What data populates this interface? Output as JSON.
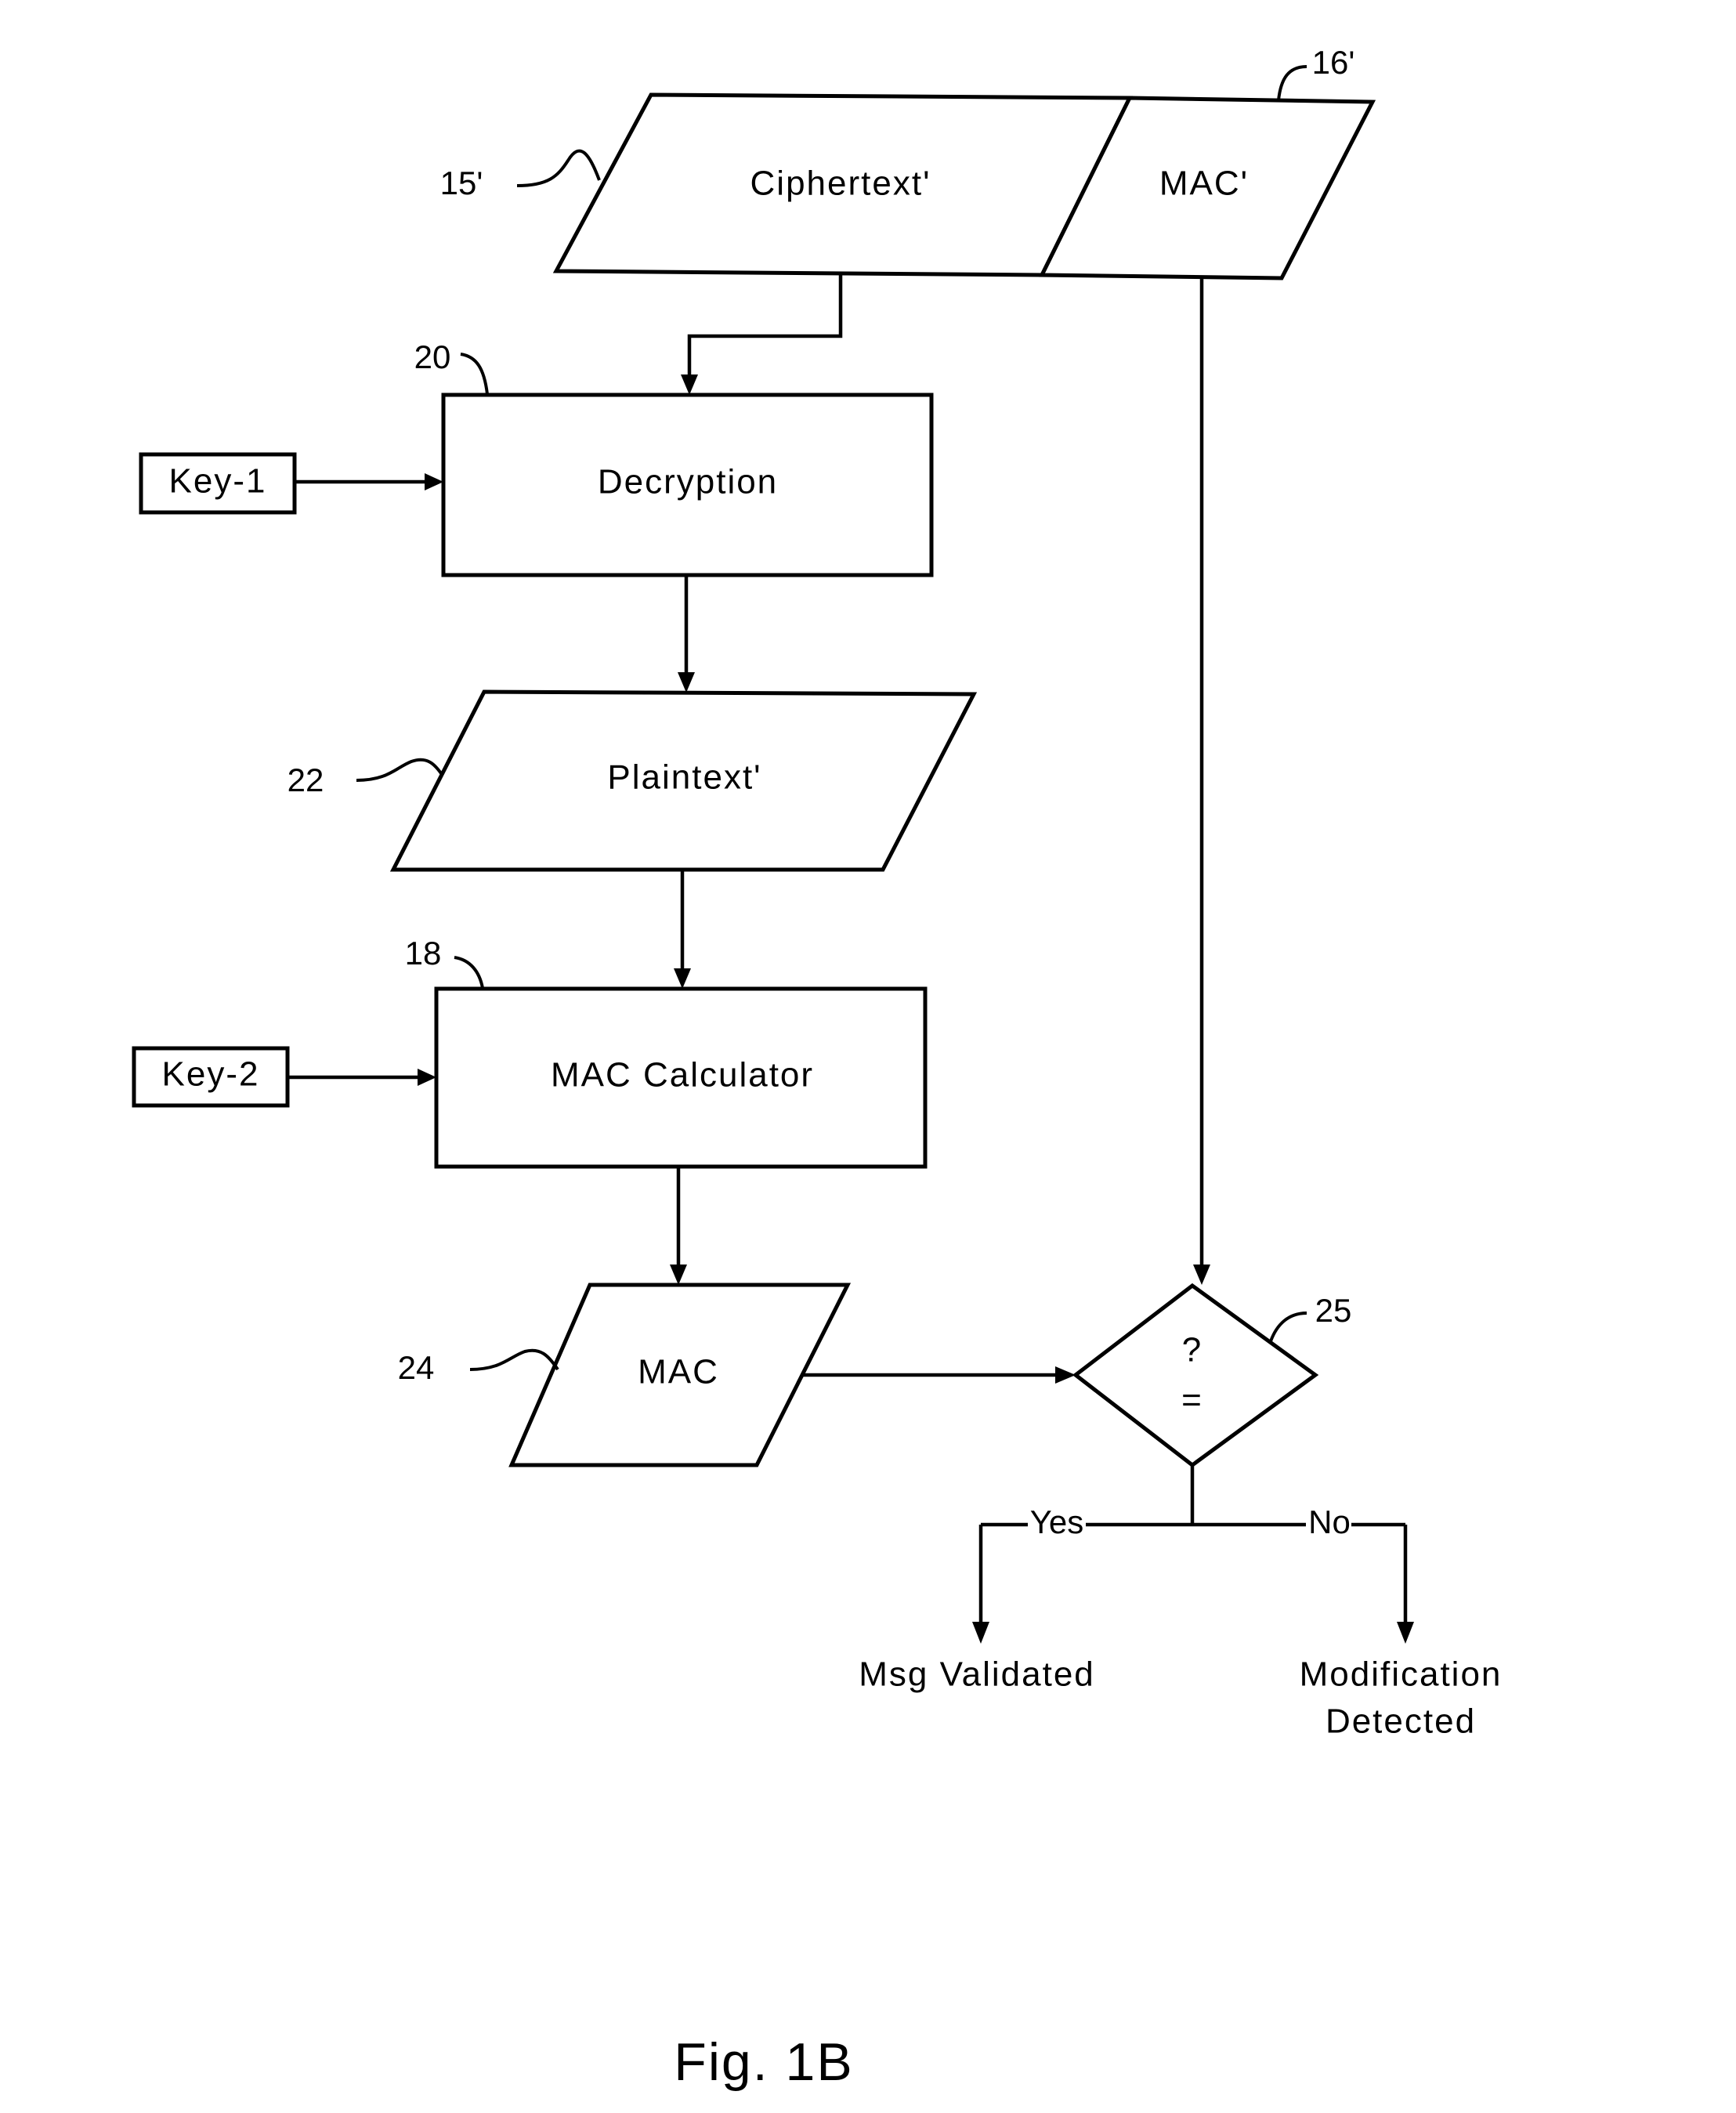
{
  "figure_label": "Fig. 1B",
  "nodes": {
    "ciphertext": {
      "label": "Ciphertext'",
      "ref": "15'"
    },
    "mac_received": {
      "label": "MAC'",
      "ref": "16'"
    },
    "decryption": {
      "label": "Decryption",
      "ref": "20"
    },
    "key1": {
      "label": "Key-1"
    },
    "plaintext": {
      "label": "Plaintext'",
      "ref": "22"
    },
    "mac_calculator": {
      "label": "MAC Calculator",
      "ref": "18"
    },
    "key2": {
      "label": "Key-2"
    },
    "mac": {
      "label": "MAC",
      "ref": "24"
    },
    "compare": {
      "label_top": "?",
      "label_bottom": "=",
      "ref": "25"
    }
  },
  "branches": {
    "yes": {
      "label": "Yes",
      "outcome": "Msg Validated"
    },
    "no": {
      "label": "No",
      "outcome_line1": "Modification",
      "outcome_line2": "Detected"
    }
  }
}
